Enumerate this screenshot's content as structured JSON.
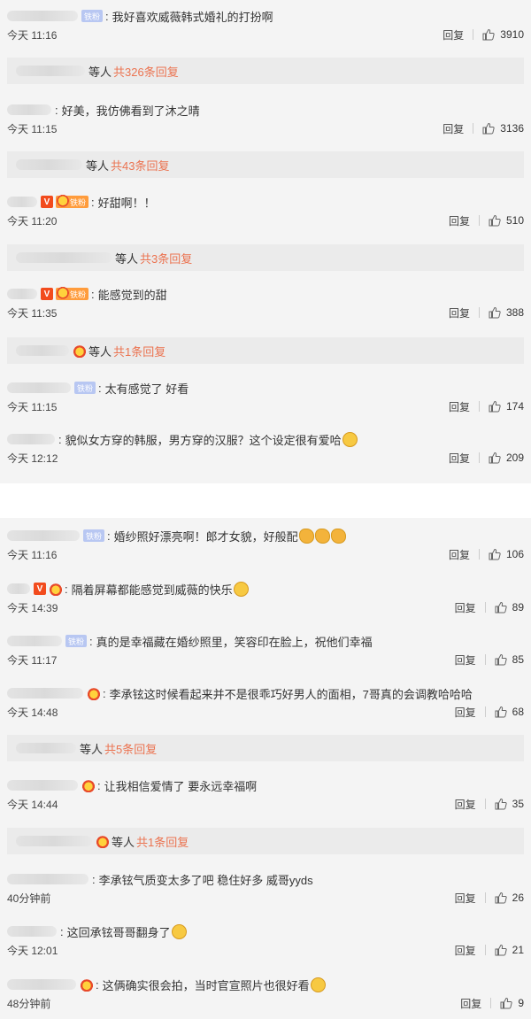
{
  "comments": [
    {
      "text": "我好喜欢威薇韩式婚礼的打扮啊",
      "time": "今天 11:16",
      "likes": "3910",
      "reply_label": "回复",
      "fan_label": "铁粉"
    },
    {
      "text": "好美，我仿佛看到了沐之晴",
      "time": "今天 11:15",
      "likes": "3136",
      "reply_label": "回复"
    },
    {
      "text": "好甜啊！！",
      "time": "今天 11:20",
      "likes": "510",
      "reply_label": "回复",
      "fan_label": "铁粉"
    },
    {
      "text": "能感觉到的甜",
      "time": "今天 11:35",
      "likes": "388",
      "reply_label": "回复",
      "fan_label": "铁粉"
    },
    {
      "text": "太有感觉了 好看",
      "time": "今天 11:15",
      "likes": "174",
      "reply_label": "回复",
      "fan_label": "铁粉"
    },
    {
      "text": "貌似女方穿的韩服，男方穿的汉服？这个设定很有爱哈",
      "time": "今天 12:12",
      "likes": "209",
      "reply_label": "回复"
    },
    {
      "text": "婚纱照好漂亮啊！郎才女貌，好般配",
      "time": "今天 11:16",
      "likes": "106",
      "reply_label": "回复",
      "fan_label": "铁粉"
    },
    {
      "text": "隔着屏幕都能感觉到威薇的快乐",
      "time": "今天 14:39",
      "likes": "89",
      "reply_label": "回复"
    },
    {
      "text": "真的是幸福藏在婚纱照里，笑容印在脸上，祝他们幸福",
      "time": "今天 11:17",
      "likes": "85",
      "reply_label": "回复",
      "fan_label": "铁粉"
    },
    {
      "text": "李承铉这时候看起来并不是很乖巧好男人的面相，7哥真的会调教哈哈哈",
      "time": "今天 14:48",
      "likes": "68",
      "reply_label": "回复"
    },
    {
      "text": "让我相信爱情了 要永远幸福啊",
      "time": "今天 14:44",
      "likes": "35",
      "reply_label": "回复"
    },
    {
      "text": "李承铉气质变太多了吧 稳住好多 威哥yyds",
      "time": "40分钟前",
      "likes": "26",
      "reply_label": "回复"
    },
    {
      "text": "这回承铉哥哥翻身了",
      "time": "今天 12:01",
      "likes": "21",
      "reply_label": "回复"
    },
    {
      "text": "这俩确实很会拍，当时官宣照片也很好看",
      "time": "48分钟前",
      "likes": "9",
      "reply_label": "回复"
    }
  ],
  "reply_bars": [
    {
      "deng": "等人",
      "total": "共326条回复"
    },
    {
      "deng": "等人",
      "total": "共43条回复"
    },
    {
      "deng": "等人",
      "total": "共3条回复"
    },
    {
      "deng": "等人",
      "total": "共1条回复"
    },
    {
      "deng": "等人",
      "total": "共5条回复"
    },
    {
      "deng": "等人",
      "total": "共1条回复"
    }
  ],
  "colors": {
    "background": "#f4f4f4",
    "reply_bar": "#ebebeb",
    "highlight": "#eb7350",
    "v_badge": "#f24b1d",
    "fan_badge": "#ff9c3c"
  },
  "icons": [
    "thumbs-up-icon",
    "v-badge-icon",
    "fan-badge-icon",
    "smile-emoji-icon",
    "clap-emoji-icon",
    "grin-emoji-icon",
    "laugh-emoji-icon"
  ]
}
